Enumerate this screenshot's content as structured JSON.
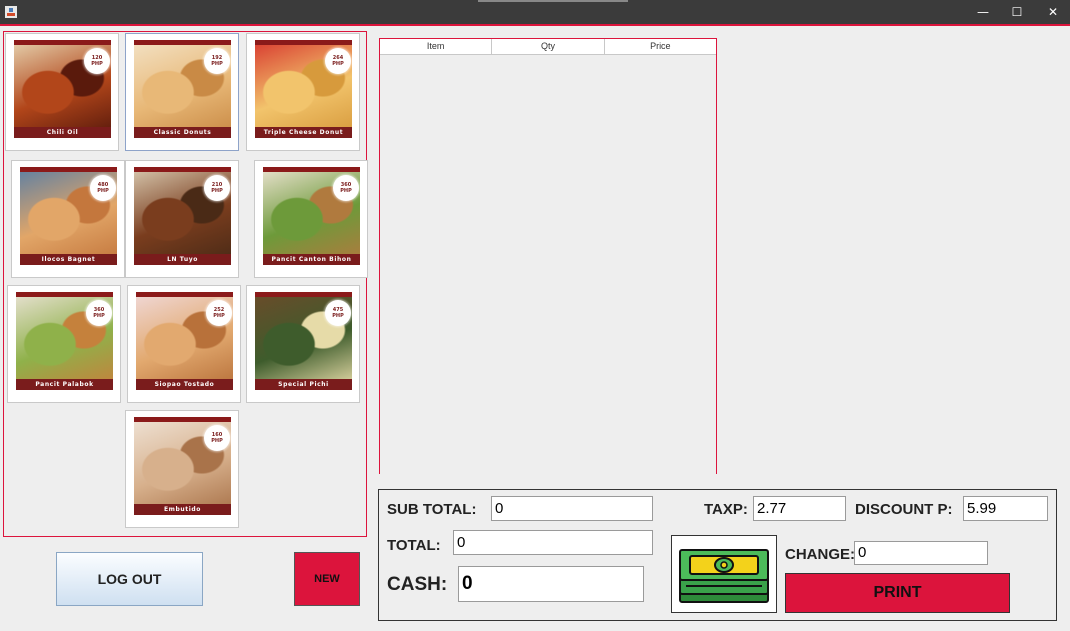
{
  "window": {
    "minimize_glyph": "—",
    "maximize_glyph": "☐",
    "close_glyph": "✕",
    "icon": "java-app-icon"
  },
  "products": [
    {
      "name": "Chili Oil",
      "price": "120",
      "unit": "PHP",
      "colors": [
        "#5a1a0c",
        "#b2461a",
        "#e6d3b0"
      ]
    },
    {
      "name": "Classic Donuts",
      "price": "192",
      "unit": "PHP",
      "colors": [
        "#c98a45",
        "#e8b877",
        "#f3e2c5"
      ]
    },
    {
      "name": "Triple Cheese Donut",
      "price": "264",
      "unit": "PHP",
      "colors": [
        "#d79a3c",
        "#f2c46c",
        "#d8392f"
      ]
    },
    {
      "name": "Ilocos Bagnet",
      "price": "480",
      "unit": "PHP",
      "colors": [
        "#c4773d",
        "#e2a668",
        "#5c7fa4"
      ]
    },
    {
      "name": "LN Tuyo",
      "price": "210",
      "unit": "PHP",
      "colors": [
        "#4a2a16",
        "#7a3d1e",
        "#d8c9b0"
      ]
    },
    {
      "name": "Pancit Canton Bihon",
      "price": "360",
      "unit": "PHP",
      "colors": [
        "#b07a3e",
        "#6d9a3a",
        "#ece3d2"
      ]
    },
    {
      "name": "Pancit Palabok",
      "price": "360",
      "unit": "PHP",
      "colors": [
        "#c5813c",
        "#8fb14a",
        "#e9e2d4"
      ]
    },
    {
      "name": "Siopao Tostado",
      "price": "252",
      "unit": "PHP",
      "colors": [
        "#b8713a",
        "#e2a96f",
        "#f0d9d9"
      ]
    },
    {
      "name": "Special Pichi",
      "price": "475",
      "unit": "PHP",
      "colors": [
        "#e6dba8",
        "#3e5c2c",
        "#6b4b2a"
      ]
    },
    {
      "name": "Embutido",
      "price": "160",
      "unit": "PHP",
      "colors": [
        "#a9734a",
        "#d7b08c",
        "#efe3d6"
      ]
    }
  ],
  "order_table": {
    "columns": [
      "Item",
      "Qty",
      "Price"
    ],
    "rows": []
  },
  "payment": {
    "subtotal_label": "SUB TOTAL:",
    "subtotal_value": "0",
    "total_label": "TOTAL:",
    "total_value": "0",
    "cash_label": "CASH:",
    "cash_value": "0",
    "tax_label": "TAXP:",
    "tax_value": "2.77",
    "discount_label": "DISCOUNT P:",
    "discount_value": "5.99",
    "change_label": "CHANGE:",
    "change_value": "0",
    "print_label": "PRINT",
    "money_icon": "cash-bills-icon"
  },
  "buttons": {
    "logout_label": "LOG OUT",
    "new_label": "NEW"
  },
  "colors": {
    "accent": "#dc143c",
    "band": "#7a1c1c",
    "titlebar": "#3b3b3b"
  }
}
